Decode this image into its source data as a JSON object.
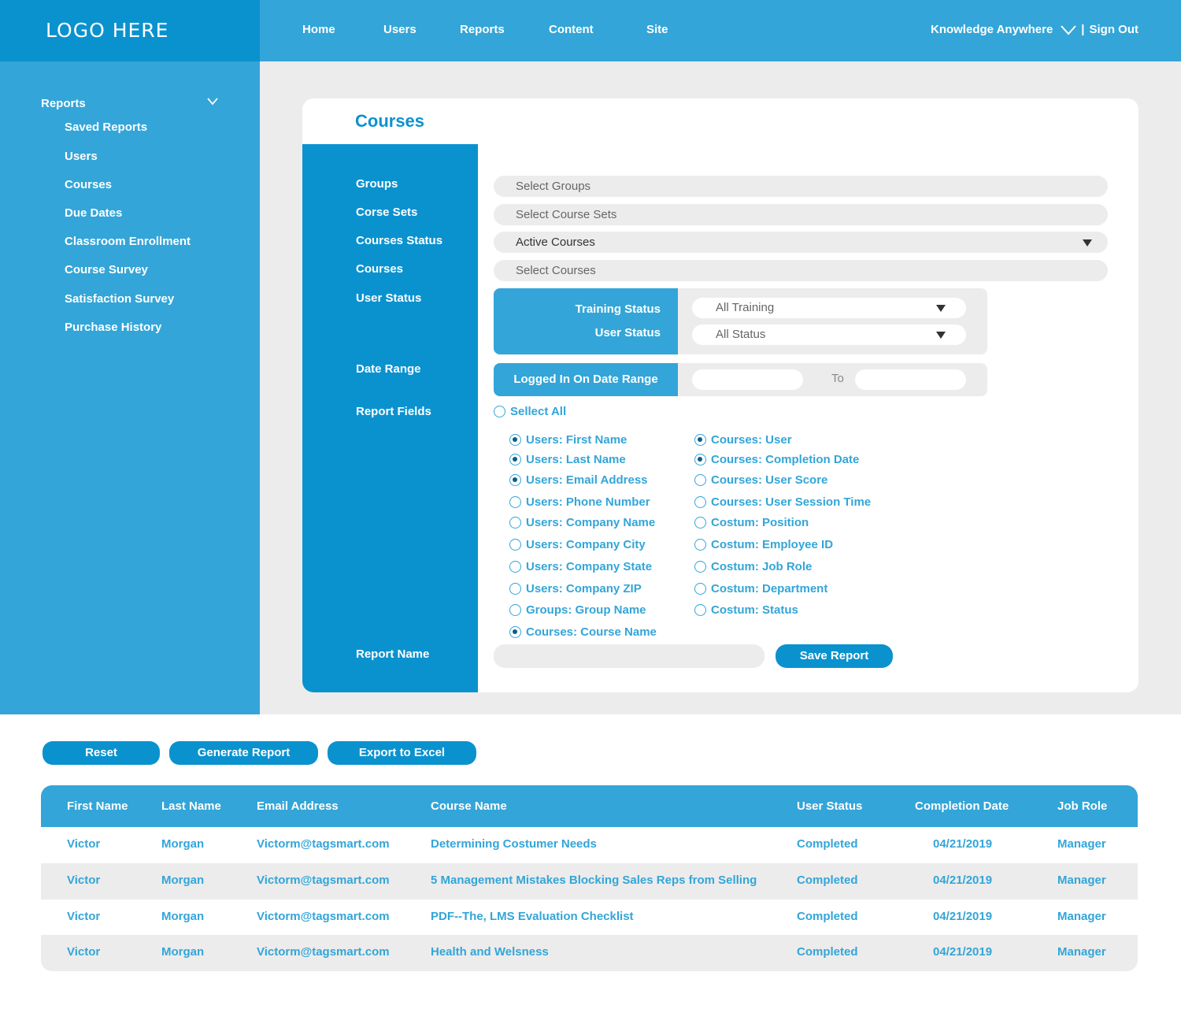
{
  "header": {
    "logo": "LOGO HERE",
    "nav": [
      "Home",
      "Users",
      "Reports",
      "Content",
      "Site"
    ],
    "account": "Knowledge Anywhere",
    "separator": "|",
    "sign_out": "Sign Out"
  },
  "sidebar": {
    "section": "Reports",
    "items": [
      "Saved Reports",
      "Users",
      "Courses",
      "Due Dates",
      "Classroom Enrollment",
      "Course Survey",
      "Satisfaction Survey",
      "Purchase History"
    ]
  },
  "form": {
    "title": "Courses",
    "labels": {
      "groups": "Groups",
      "course_sets": "Corse Sets",
      "courses_status": "Courses Status",
      "courses": "Courses",
      "user_status": "User Status",
      "date_range": "Date Range",
      "report_fields": "Report Fields",
      "report_name": "Report Name"
    },
    "groups_placeholder": "Select Groups",
    "course_sets_placeholder": "Select Course Sets",
    "courses_status_value": "Active Courses",
    "courses_placeholder": "Select Courses",
    "training_status_label": "Training Status",
    "training_status_value": "All Training",
    "user_status_label": "User Status",
    "user_status_value": "All Status",
    "date_range_label": "Logged In On Date Range",
    "date_to": "To",
    "select_all": "Sellect All",
    "fields_left": [
      {
        "label": "Users: First Name",
        "checked": true
      },
      {
        "label": "Users: Last Name",
        "checked": true
      },
      {
        "label": "Users: Email Address",
        "checked": true
      },
      {
        "label": "Users: Phone Number",
        "checked": false
      },
      {
        "label": "Users: Company Name",
        "checked": false
      },
      {
        "label": "Users: Company City",
        "checked": false
      },
      {
        "label": "Users: Company State",
        "checked": false
      },
      {
        "label": "Users: Company ZIP",
        "checked": false
      },
      {
        "label": "Groups: Group Name",
        "checked": false
      },
      {
        "label": "Courses: Course Name",
        "checked": true
      }
    ],
    "fields_right": [
      {
        "label": "Courses: User",
        "checked": true
      },
      {
        "label": "Courses: Completion Date",
        "checked": true
      },
      {
        "label": "Courses: User Score",
        "checked": false
      },
      {
        "label": "Courses: User Session Time",
        "checked": false
      },
      {
        "label": "Costum: Position",
        "checked": false
      },
      {
        "label": "Costum: Employee ID",
        "checked": false
      },
      {
        "label": "Costum: Job Role",
        "checked": false
      },
      {
        "label": "Costum: Department",
        "checked": false
      },
      {
        "label": "Costum: Status",
        "checked": false
      }
    ],
    "save_report": "Save Report"
  },
  "actions": {
    "reset": "Reset",
    "generate": "Generate Report",
    "export": "Export to Excel"
  },
  "table": {
    "columns": [
      "First Name",
      "Last Name",
      "Email Address",
      "Course Name",
      "User Status",
      "Completion Date",
      "Job Role"
    ],
    "rows": [
      [
        "Victor",
        "Morgan",
        "Victorm@tagsmart.com",
        "Determining Costumer Needs",
        "Completed",
        "04/21/2019",
        "Manager"
      ],
      [
        "Victor",
        "Morgan",
        "Victorm@tagsmart.com",
        "5 Management Mistakes Blocking Sales Reps from Selling",
        "Completed",
        "04/21/2019",
        "Manager"
      ],
      [
        "Victor",
        "Morgan",
        "Victorm@tagsmart.com",
        "PDF--The, LMS Evaluation Checklist",
        "Completed",
        "04/21/2019",
        "Manager"
      ],
      [
        "Victor",
        "Morgan",
        "Victorm@tagsmart.com",
        "Health and Welsness",
        "Completed",
        "04/21/2019",
        "Manager"
      ]
    ]
  }
}
